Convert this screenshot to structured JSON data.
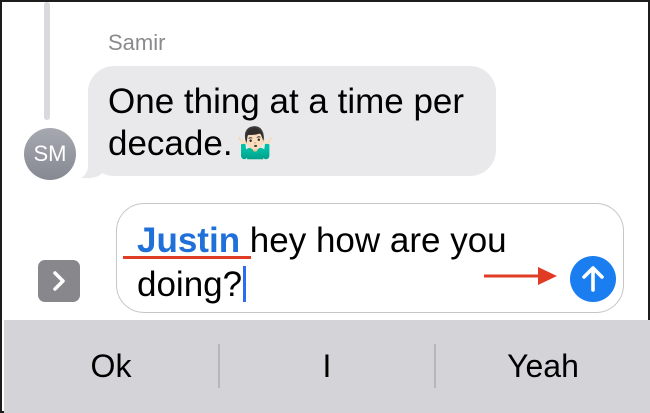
{
  "thread": {
    "sender_name": "Samir",
    "avatar_initials": "SM",
    "message_text": "One thing at a time per decade.",
    "message_emoji": "🤷🏻‍♂️"
  },
  "compose": {
    "mention": "Justin",
    "text": " hey how are you doing?"
  },
  "annotation": {
    "color": "#e03b24"
  },
  "icons": {
    "apps": "chevron-right-icon",
    "send": "arrow-up-icon"
  },
  "colors": {
    "mention": "#1f70d9",
    "send_button": "#1a7ef0",
    "bubble": "#e9e9eb",
    "keyboard_bar": "#d3d3d8"
  },
  "predictive_bar": {
    "suggestions": [
      "Ok",
      "I",
      "Yeah"
    ]
  }
}
